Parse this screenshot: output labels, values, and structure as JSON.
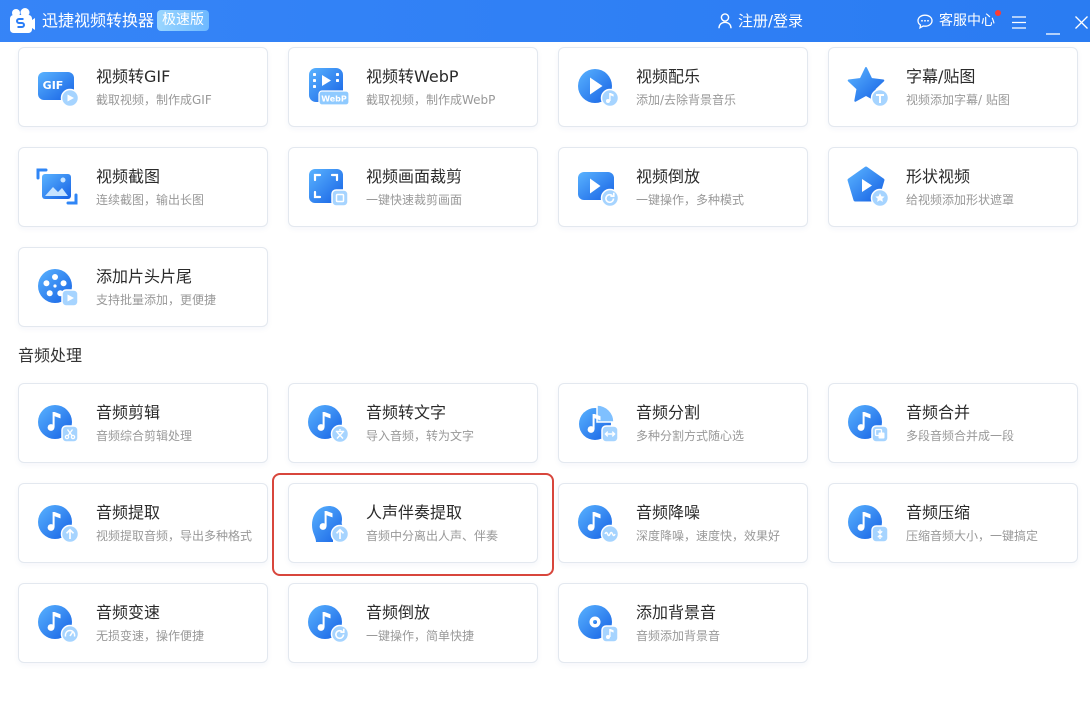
{
  "app": {
    "title": "迅捷视频转换器",
    "edition_badge": "极速版",
    "logo_icon": "app-logo-icon",
    "colors": {
      "title_bar": "#2b7ef7",
      "highlight": "#d8463c",
      "notification_dot": "#ff3b30"
    }
  },
  "titlebar": {
    "login_icon": "user-icon",
    "login_label": "注册/登录",
    "support_icon": "chat-icon",
    "support_label": "客服中心",
    "support_notification": true,
    "window_controls": [
      "menu-icon",
      "minimize-icon",
      "close-icon"
    ]
  },
  "video_tools": [
    {
      "title": "视频转GIF",
      "desc": "截取视频，制作成GIF",
      "icon": "gif-icon",
      "icon_text": "GIF"
    },
    {
      "title": "视频转WebP",
      "desc": "截取视频，制作成WebP",
      "icon": "webp-icon",
      "icon_text": "WebP"
    },
    {
      "title": "视频配乐",
      "desc": "添加/去除背景音乐",
      "icon": "video-music-icon"
    },
    {
      "title": "字幕/贴图",
      "desc": "视频添加字幕/ 贴图",
      "icon": "subtitle-sticker-icon"
    },
    {
      "title": "视频截图",
      "desc": "连续截图，输出长图",
      "icon": "screenshot-icon"
    },
    {
      "title": "视频画面裁剪",
      "desc": "一键快速裁剪画面",
      "icon": "crop-icon"
    },
    {
      "title": "视频倒放",
      "desc": "一键操作，多种模式",
      "icon": "video-reverse-icon"
    },
    {
      "title": "形状视频",
      "desc": "给视频添加形状遮罩",
      "icon": "shape-video-icon"
    },
    {
      "title": "添加片头片尾",
      "desc": "支持批量添加，更便捷",
      "icon": "intro-outro-icon"
    }
  ],
  "audio_section": {
    "heading": "音频处理",
    "tools": [
      {
        "title": "音频剪辑",
        "desc": "音频综合剪辑处理",
        "icon": "audio-cut-icon"
      },
      {
        "title": "音频转文字",
        "desc": "导入音频，转为文字",
        "icon": "audio-to-text-icon"
      },
      {
        "title": "音频分割",
        "desc": "多种分割方式随心选",
        "icon": "audio-split-icon"
      },
      {
        "title": "音频合并",
        "desc": "多段音频合并成一段",
        "icon": "audio-merge-icon"
      },
      {
        "title": "音频提取",
        "desc": "视频提取音频，导出多种格式",
        "icon": "audio-extract-icon"
      },
      {
        "title": "人声伴奏提取",
        "desc": "音频中分离出人声、伴奏",
        "icon": "vocal-extract-icon",
        "highlighted": true
      },
      {
        "title": "音频降噪",
        "desc": "深度降噪，速度快，效果好",
        "icon": "audio-denoise-icon"
      },
      {
        "title": "音频压缩",
        "desc": "压缩音频大小，一键搞定",
        "icon": "audio-compress-icon"
      },
      {
        "title": "音频变速",
        "desc": "无损变速，操作便捷",
        "icon": "audio-speed-icon"
      },
      {
        "title": "音频倒放",
        "desc": "一键操作，简单快捷",
        "icon": "audio-reverse-icon"
      },
      {
        "title": "添加背景音",
        "desc": "音频添加背景音",
        "icon": "add-bgm-icon"
      }
    ]
  }
}
